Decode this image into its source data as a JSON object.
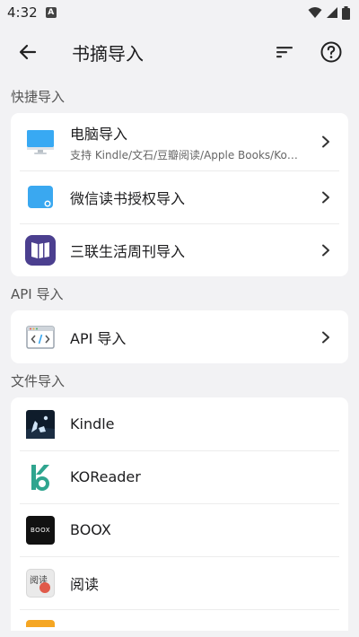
{
  "status": {
    "time": "4:32",
    "badge": "A"
  },
  "appbar": {
    "title": "书摘导入"
  },
  "sections": {
    "quick": {
      "header": "快捷导入",
      "items": [
        {
          "title": "电脑导入",
          "subtitle": "支持 Kindle/文石/豆瓣阅读/Apple Books/Ko…"
        },
        {
          "title": "微信读书授权导入"
        },
        {
          "title": "三联生活周刊导入"
        }
      ]
    },
    "api": {
      "header": "API 导入",
      "items": [
        {
          "title": "API 导入"
        }
      ]
    },
    "files": {
      "header": "文件导入",
      "items": [
        {
          "title": "Kindle"
        },
        {
          "title": "KOReader"
        },
        {
          "title": "BOOX",
          "logo_text": "BOOX"
        },
        {
          "title": "阅读",
          "logo_text": "阅读"
        }
      ]
    }
  },
  "colors": {
    "accent_blue": "#3aa8f0",
    "sanlian_purple": "#4b3f8f",
    "koreader_green": "#2fa58f",
    "background": "#f2f2f4"
  }
}
